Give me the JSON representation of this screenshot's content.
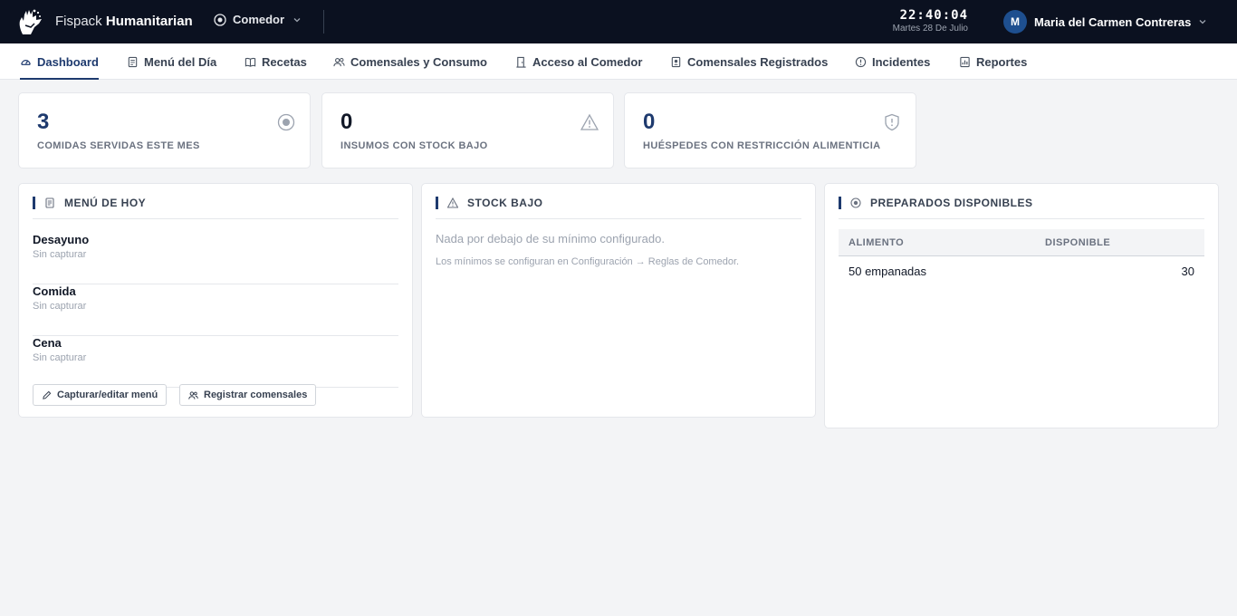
{
  "app": {
    "brand_light": "Fispack",
    "brand_bold": "Humanitarian",
    "module": "Comedor",
    "time": "22:40:04",
    "date": "Martes 28 De Julio",
    "user_initial": "M",
    "user_name": "Maria del Carmen Contreras"
  },
  "nav": {
    "items": [
      {
        "label": "Dashboard",
        "icon": "gauge-icon"
      },
      {
        "label": "Menú del Día",
        "icon": "document-icon"
      },
      {
        "label": "Recetas",
        "icon": "book-icon"
      },
      {
        "label": "Comensales y Consumo",
        "icon": "users-icon"
      },
      {
        "label": "Acceso al Comedor",
        "icon": "door-icon"
      },
      {
        "label": "Comensales Registrados",
        "icon": "id-badge-icon"
      },
      {
        "label": "Incidentes",
        "icon": "alert-circle-icon"
      },
      {
        "label": "Reportes",
        "icon": "chart-icon"
      }
    ],
    "active": "Dashboard"
  },
  "stats": [
    {
      "value": "3",
      "label": "COMIDAS SERVIDAS ESTE MES",
      "icon": "plate-icon",
      "color": "#1e3a6e"
    },
    {
      "value": "0",
      "label": "INSUMOS CON STOCK BAJO",
      "icon": "warning-icon",
      "color": "#111827"
    },
    {
      "value": "0",
      "label": "HUÉSPEDES CON RESTRICCIÓN ALIMENTICIA",
      "icon": "shield-alert-icon",
      "color": "#1e3a6e"
    }
  ],
  "menu_today": {
    "title": "MENÚ DE HOY",
    "meals": [
      {
        "name": "Desayuno",
        "status": "Sin capturar"
      },
      {
        "name": "Comida",
        "status": "Sin capturar"
      },
      {
        "name": "Cena",
        "status": "Sin capturar"
      }
    ],
    "edit_label": "Capturar/editar menú",
    "register_label": "Registrar comensales"
  },
  "stock_low": {
    "title": "STOCK BAJO",
    "empty_message": "Nada por debajo de su mínimo configurado.",
    "hint": "Los mínimos se configuran en Configuración → Reglas de Comedor."
  },
  "prepared": {
    "title": "PREPARADOS DISPONIBLES",
    "columns": [
      "ALIMENTO",
      "DISPONIBLE"
    ],
    "rows": [
      {
        "food": "50 empanadas",
        "available": "30"
      }
    ]
  },
  "colors": {
    "topbar": "#0b1120",
    "accent": "#1e3a6e",
    "avatar": "#1e4f8f"
  }
}
